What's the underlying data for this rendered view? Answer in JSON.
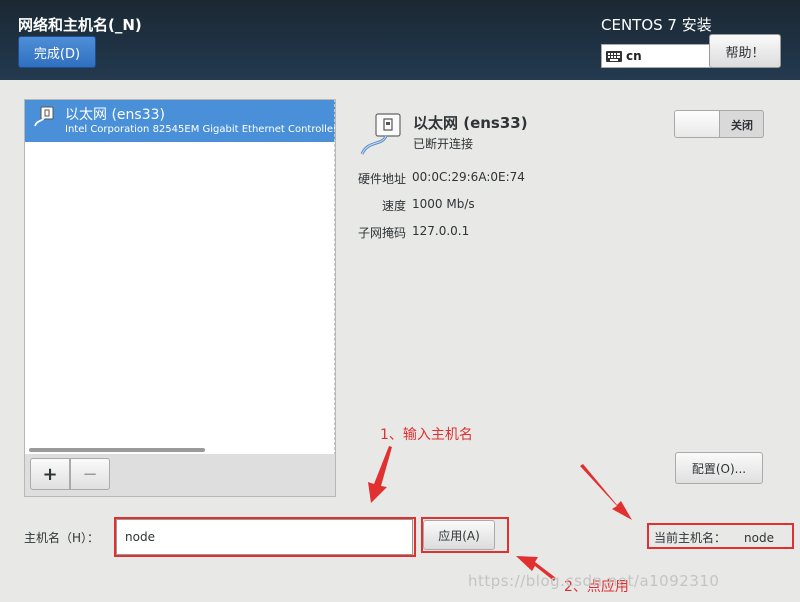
{
  "header": {
    "title": "网络和主机名(_N)",
    "done_label": "完成(D)",
    "product": "CENTOS 7 安装",
    "keyboard_layout": "cn",
    "help_label": "帮助！"
  },
  "device_list": {
    "items": [
      {
        "name": "以太网 (ens33)",
        "description": "Intel Corporation 82545EM Gigabit Ethernet Controller ("
      }
    ],
    "add_label": "+",
    "remove_label": "−"
  },
  "device_details": {
    "name": "以太网 (ens33)",
    "status": "已断开连接",
    "toggle_label": "关闭",
    "toggle_on": false,
    "hardware_address_label": "硬件地址",
    "hardware_address": "00:0C:29:6A:0E:74",
    "speed_label": "速度",
    "speed": "1000 Mb/s",
    "subnet_mask_label": "子网掩码",
    "subnet_mask": "127.0.0.1",
    "configure_label": "配置(O)..."
  },
  "hostname": {
    "label": "主机名（H）：",
    "value": "node",
    "apply_label": "应用(A)",
    "current_label": "当前主机名：",
    "current_value": "node"
  },
  "annotations": {
    "step1": "1、输入主机名",
    "step2": "2、点应用",
    "color": "#e03030"
  },
  "watermark": "https://blog.csdn.net/a1092310"
}
